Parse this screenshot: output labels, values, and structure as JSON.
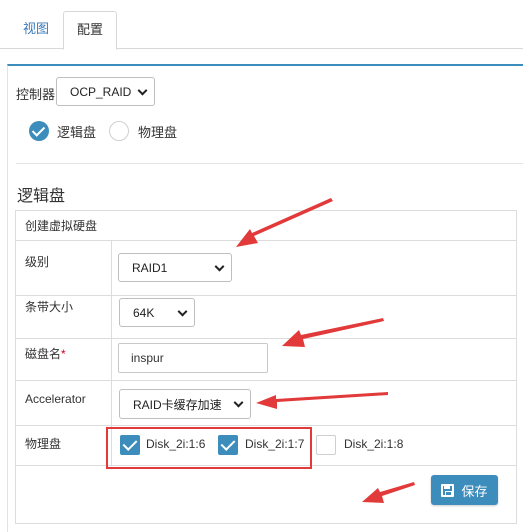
{
  "tabs": [
    {
      "label": "视图",
      "active": false
    },
    {
      "label": "配置",
      "active": true
    }
  ],
  "controller": {
    "label": "控制器",
    "selected": "OCP_RAID"
  },
  "disk_mode": {
    "logical_label": "逻辑盘",
    "physical_label": "物理盘",
    "selected": "逻辑盘"
  },
  "section_title": "逻辑盘",
  "form": {
    "header": "创建虚拟硬盘",
    "level_label": "级别",
    "level_value": "RAID1",
    "stripe_label": "条带大小",
    "stripe_value": "64K",
    "disk_name_label": "磁盘名",
    "disk_name_required": "*",
    "disk_name_value": "inspur",
    "accelerator_label": "Accelerator",
    "accelerator_value": "RAID卡缓存加速",
    "physical_label": "物理盘",
    "disks": [
      {
        "name": "Disk_2i:1:6",
        "checked": true
      },
      {
        "name": "Disk_2i:1:7",
        "checked": true
      },
      {
        "name": "Disk_2i:1:8",
        "checked": false
      }
    ],
    "save_label": "保存"
  },
  "colors": {
    "accent": "#3c8dbc",
    "annotation": "#e23a3a"
  }
}
